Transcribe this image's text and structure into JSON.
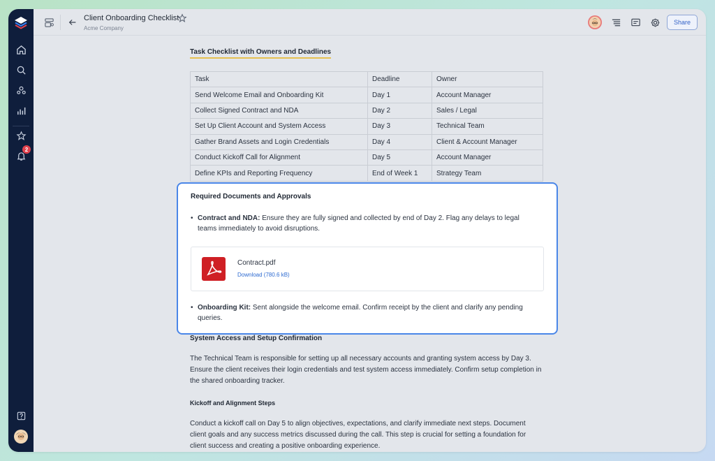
{
  "topbar": {
    "title": "Client Onboarding Checklist",
    "subtitle": "Acme Company",
    "share_label": "Share"
  },
  "sidebar": {
    "notification_count": "2"
  },
  "doc": {
    "table_heading": "Task Checklist with Owners and Deadlines",
    "table": {
      "headers": [
        "Task",
        "Deadline",
        "Owner"
      ],
      "rows": [
        [
          "Send Welcome Email and Onboarding Kit",
          "Day 1",
          "Account Manager"
        ],
        [
          "Collect Signed Contract and NDA",
          "Day 2",
          "Sales / Legal"
        ],
        [
          "Set Up Client Account and System Access",
          "Day 3",
          "Technical Team"
        ],
        [
          "Gather Brand Assets and Login Credentials",
          "Day 4",
          "Client & Account Manager"
        ],
        [
          "Conduct Kickoff Call for Alignment",
          "Day 5",
          "Account Manager"
        ],
        [
          "Define KPIs and Reporting Frequency",
          "End of Week 1",
          "Strategy Team"
        ]
      ]
    },
    "card": {
      "title": "Required Documents and Approvals",
      "bullet1_bold": "Contract and NDA:",
      "bullet1_text": " Ensure they are fully signed and collected by end of Day 2. Flag any delays to legal teams immediately to avoid disruptions.",
      "file_name": "Contract.pdf",
      "file_link": "Download (780.6 kB)",
      "bullet2_bold": "Onboarding Kit:",
      "bullet2_text": " Sent alongside the welcome email. Confirm receipt by the client and clarify any pending queries."
    },
    "section1_heading": "System Access and Setup Confirmation",
    "section1_text": "The Technical Team is responsible for setting up all necessary accounts and granting system access by Day 3. Ensure the client receives their login credentials and test system access immediately. Confirm setup completion in the shared onboarding tracker.",
    "section2_heading": "Kickoff and Alignment Steps",
    "section2_text": "Conduct a kickoff call on Day 5 to align objectives, expectations, and clarify immediate next steps. Document client goals and any success metrics discussed during the call. This step is crucial for setting a foundation for client success and creating a positive onboarding experience."
  }
}
